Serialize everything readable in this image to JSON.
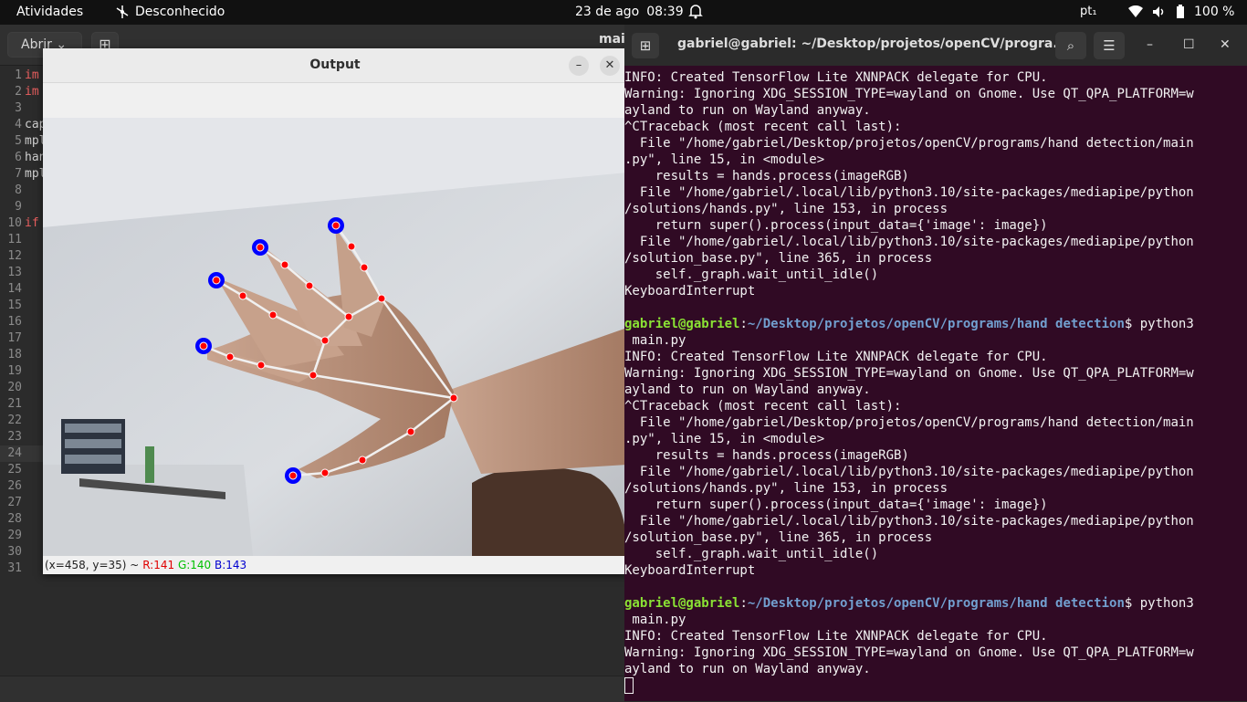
{
  "topbar": {
    "activities": "Atividades",
    "app": "Desconhecido",
    "date": "23 de ago",
    "time": "08:39",
    "lang": "pt₁",
    "battery": "100 %"
  },
  "editor": {
    "open_label": "Abrir",
    "title": "mai",
    "line_numbers": [
      "1",
      "2",
      "3",
      "4",
      "5",
      "6",
      "7",
      "8",
      "9",
      "10",
      "11",
      "12",
      "13",
      "14",
      "15",
      "16",
      "17",
      "18",
      "19",
      "20",
      "21",
      "22",
      "23",
      "24",
      "25",
      "26",
      "27",
      "28",
      "29",
      "30",
      "31"
    ],
    "code_fragments": {
      "l1": "im",
      "l2": "im",
      "l4": "cap",
      "l5": "mpl",
      "l6": "han",
      "l7": "mpl",
      "l10": "if"
    }
  },
  "output": {
    "title": "Output",
    "status_coords": "(x=458, y=35) ~",
    "status_r": "R:141",
    "status_g": "G:140",
    "status_b": "B:143"
  },
  "terminal": {
    "title": "gabriel@gabriel: ~/Desktop/projetos/openCV/progra...",
    "prompt_user": "gabriel@gabriel",
    "prompt_path": "~/Desktop/projetos/openCV/programs/hand detection",
    "lines": {
      "a1": "INFO: Created TensorFlow Lite XNNPACK delegate for CPU.",
      "a2": "Warning: Ignoring XDG_SESSION_TYPE=wayland on Gnome. Use QT_QPA_PLATFORM=w",
      "a3": "ayland to run on Wayland anyway.",
      "a4": "^CTraceback (most recent call last):",
      "a5": "  File \"/home/gabriel/Desktop/projetos/openCV/programs/hand detection/main",
      "a6": ".py\", line 15, in <module>",
      "a7": "    results = hands.process(imageRGB)",
      "a8": "  File \"/home/gabriel/.local/lib/python3.10/site-packages/mediapipe/python",
      "a9": "/solutions/hands.py\", line 153, in process",
      "a10": "    return super().process(input_data={'image': image})",
      "a11": "  File \"/home/gabriel/.local/lib/python3.10/site-packages/mediapipe/python",
      "a12": "/solution_base.py\", line 365, in process",
      "a13": "    self._graph.wait_until_idle()",
      "a14": "KeyboardInterrupt",
      "cmd_suffix": "$ python3",
      "cmd_cont": " main.py"
    }
  }
}
